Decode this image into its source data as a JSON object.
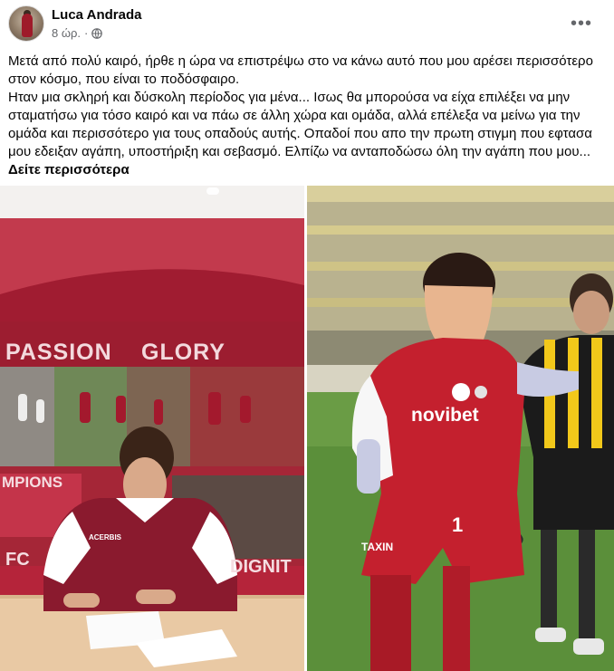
{
  "post": {
    "author": "Luca Andrada",
    "time": "8 ώρ.",
    "separator": "·",
    "globe_icon": "globe-icon",
    "more_icon": "more-horizontal-icon",
    "paragraph1": "Μετά από πολύ καιρό, ήρθε η ώρα να επιστρέψω στο να κάνω αυτό που μου αρέσει περισσότερο στον κόσμο, που είναι το ποδόσφαιρο.",
    "paragraph2": "Ηταν μια σκληρή και δύσκολη περίοδος για μένα... Ισως θα μπορούσα να είχα επιλέξει να μην σταματήσω για τόσο καιρό και να πάω σε άλλη χώρα και ομάδα, αλλά επέλεξα να μείνω για την ομάδα και περισσότερο για τους οπαδούς αυτής. Οπαδοί που απο την πρωτη στιγμη που εφτασα μου εδειξαν αγάπη, υποστήριξη και σεβασμό. Ελπίζω να ανταποδώσω όλη την αγάπη που μου...",
    "see_more": "Δείτε περισσότερα"
  },
  "photo_left": {
    "wall_word1": "PASSION",
    "wall_word2": "GLORY",
    "wall_word3": "DIGNIT",
    "wall_word4": "FC",
    "wall_word5": "MPIONS",
    "shirt_sponsor": "ACERBIS",
    "colors": {
      "wall_red": "#b5243a",
      "shirt": "#8a1a2e",
      "desk": "#e9c9a4"
    }
  },
  "photo_right": {
    "sponsor": "novibet",
    "shorts_number": "1",
    "shorts_text": "TAXIN",
    "colors": {
      "kit_red": "#c4202e",
      "opponent_yellow": "#f2c81a",
      "pitch": "#5b8f3a"
    }
  }
}
